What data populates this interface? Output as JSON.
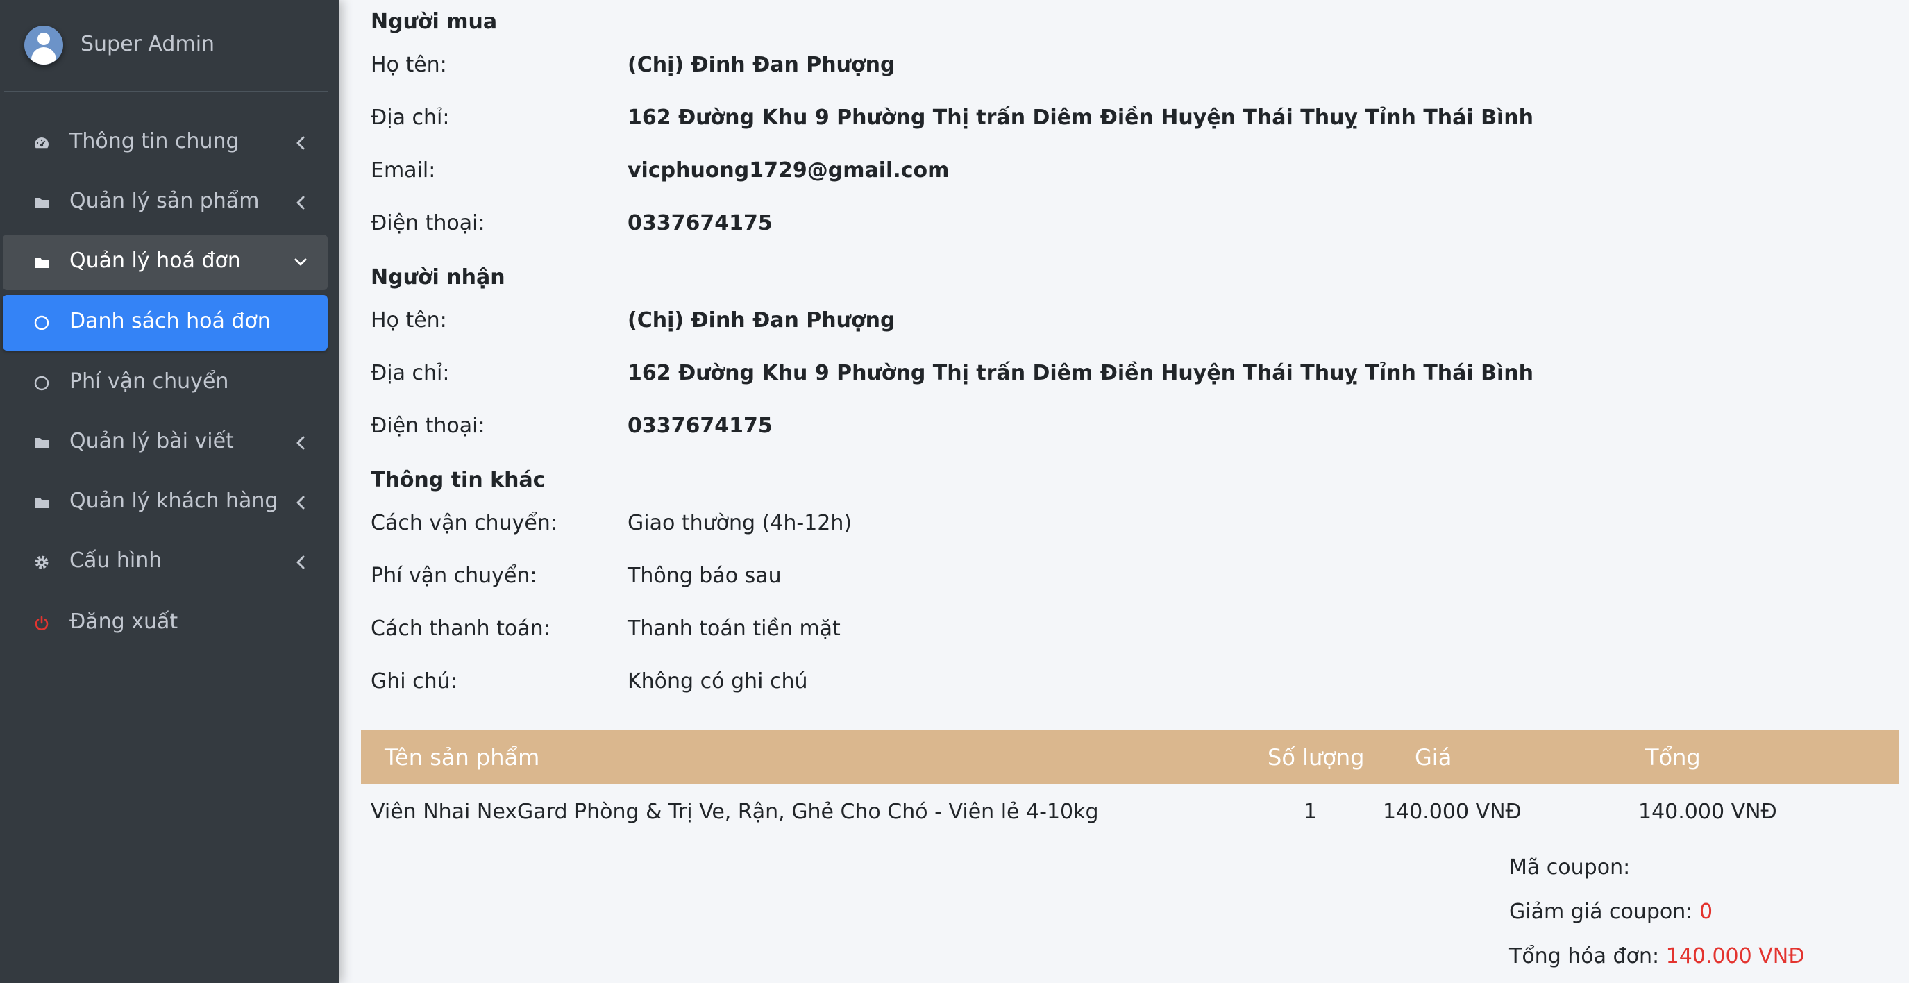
{
  "sidebar": {
    "user_name": "Super Admin",
    "items": [
      {
        "label": "Thông tin chung",
        "icon": "dashboard-icon",
        "state": "collapsed"
      },
      {
        "label": "Quản lý sản phẩm",
        "icon": "folder-icon",
        "state": "collapsed"
      },
      {
        "label": "Quản lý hoá đơn",
        "icon": "folder-icon",
        "state": "open"
      },
      {
        "label": "Danh sách hoá đơn",
        "icon": "circle-icon",
        "state": "active"
      },
      {
        "label": "Phí vận chuyển",
        "icon": "circle-icon",
        "state": "normal"
      },
      {
        "label": "Quản lý bài viết",
        "icon": "folder-icon",
        "state": "collapsed"
      },
      {
        "label": "Quản lý khách hàng",
        "icon": "folder-icon",
        "state": "collapsed"
      },
      {
        "label": "Cấu hình",
        "icon": "gear-icon",
        "state": "collapsed"
      },
      {
        "label": "Đăng xuất",
        "icon": "power-icon",
        "state": "normal"
      }
    ]
  },
  "buyer": {
    "title": "Người mua",
    "name_label": "Họ tên:",
    "name": "(Chị) Đinh Đan Phượng",
    "address_label": "Địa chỉ:",
    "address": "162 Đường Khu 9 Phường Thị trấn Diêm Điền Huyện Thái Thuỵ Tỉnh Thái Bình",
    "email_label": "Email:",
    "email": "vicphuong1729@gmail.com",
    "phone_label": "Điện thoại:",
    "phone": "0337674175"
  },
  "receiver": {
    "title": "Người nhận",
    "name_label": "Họ tên:",
    "name": "(Chị) Đinh Đan Phượng",
    "address_label": "Địa chỉ:",
    "address": "162 Đường Khu 9 Phường Thị trấn Diêm Điền Huyện Thái Thuỵ Tỉnh Thái Bình",
    "phone_label": "Điện thoại:",
    "phone": "0337674175"
  },
  "other": {
    "title": "Thông tin khác",
    "shipping_method_label": "Cách vận chuyển:",
    "shipping_method": "Giao thường (4h-12h)",
    "shipping_fee_label": "Phí vận chuyển:",
    "shipping_fee": "Thông báo sau",
    "payment_label": "Cách thanh toán:",
    "payment": "Thanh toán tiền mặt",
    "note_label": "Ghi chú:",
    "note": "Không có ghi chú"
  },
  "table": {
    "headers": [
      "Tên sản phẩm",
      "Số lượng",
      "Giá",
      "Tổng"
    ],
    "rows": [
      [
        "Viên Nhai NexGard Phòng & Trị Ve, Rận, Ghẻ Cho Chó - Viên lẻ 4-10kg",
        "1",
        "140.000 VNĐ",
        "140.000 VNĐ"
      ]
    ]
  },
  "summary": {
    "coupon_label": "Mã coupon:",
    "coupon_value": "",
    "discount_label": "Giảm giá coupon:",
    "discount_value": "0",
    "total_label": "Tổng hóa đơn:",
    "total_value": "140.000 VNĐ"
  },
  "colors": {
    "sidebar_bg": "#343a40",
    "active_item": "#3483f6",
    "table_header": "#dab78e",
    "highlight_red": "#e3342f",
    "logout_icon": "#e3342f"
  }
}
